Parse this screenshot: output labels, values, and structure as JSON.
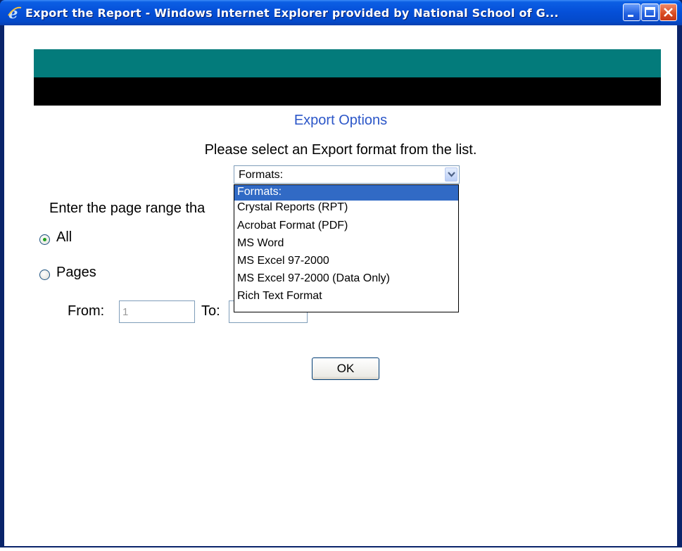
{
  "window": {
    "title": "Export the Report - Windows Internet Explorer provided by National School of G..."
  },
  "page": {
    "heading": "Export Options",
    "instruction": "Please select an Export format from the list.",
    "format_select": {
      "selected": "Formats:",
      "options": [
        "Formats:",
        "Crystal Reports (RPT)",
        "Acrobat Format (PDF)",
        "MS Word",
        "MS Excel 97-2000",
        "MS Excel 97-2000 (Data Only)",
        "Rich Text Format"
      ],
      "highlighted_index": 0
    },
    "range_label": "Enter the page range tha",
    "radios": [
      {
        "label": "All",
        "checked": true
      },
      {
        "label": "Pages",
        "checked": false
      }
    ],
    "from_label": "From:",
    "from_value": "1",
    "to_label": "To:",
    "to_value": "",
    "ok_label": "OK"
  },
  "colors": {
    "titlebar": "#0550d9",
    "banner_top": "#037b7b",
    "banner_bottom": "#000000",
    "heading": "#2b56c8",
    "selection": "#316ac5"
  },
  "icons": {
    "app": "internet-explorer-icon",
    "minimize": "minimize-icon",
    "maximize": "maximize-icon",
    "close": "close-icon",
    "dropdown": "chevron-down-icon"
  }
}
